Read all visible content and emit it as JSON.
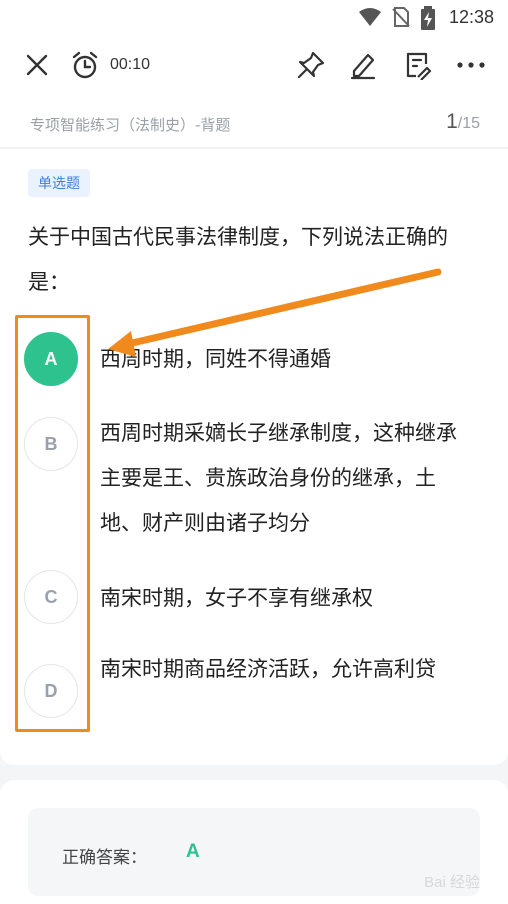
{
  "status_bar": {
    "time": "12:38",
    "icons": [
      "wifi-icon",
      "no-sim-icon",
      "battery-charging-icon"
    ]
  },
  "toolbar": {
    "timer": "00:10",
    "icons": [
      "close-icon",
      "alarm-clock-icon",
      "pin-icon",
      "pencil-icon",
      "note-icon",
      "more-icon"
    ]
  },
  "header": {
    "breadcrumb": "专项智能练习（法制史）-背题",
    "current_index": "1",
    "total": "/15"
  },
  "question": {
    "type_tag": "单选题",
    "text": "关于中国古代民事法律制度，下列说法正确的是：",
    "options": [
      {
        "letter": "A",
        "text": "西周时期，同姓不得通婚",
        "selected": true
      },
      {
        "letter": "B",
        "text": "西周时期采嫡长子继承制度，这种继承主要是王、贵族政治身份的继承，土地、财产则由诸子均分",
        "selected": false
      },
      {
        "letter": "C",
        "text": "南宋时期，女子不享有继承权",
        "selected": false
      },
      {
        "letter": "D",
        "text": "南宋时期商品经济活跃，允许高利贷",
        "selected": false
      }
    ]
  },
  "answer": {
    "label": "正确答案：",
    "value": "A"
  },
  "colors": {
    "accent_green": "#2ec28f",
    "annotation_orange": "#f08a1c",
    "tag_blue": "#3d7fe0"
  },
  "watermark": "Bai 经验"
}
